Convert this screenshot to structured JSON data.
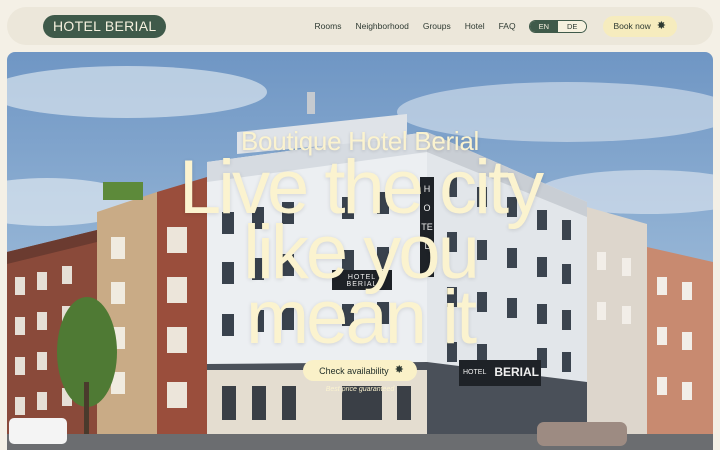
{
  "brand": {
    "logo_text": "HOTEL BERIAL"
  },
  "nav": {
    "links": [
      "Rooms",
      "Neighborhood",
      "Groups",
      "Hotel",
      "FAQ"
    ],
    "languages": [
      "EN",
      "DE"
    ],
    "active_language": "EN",
    "book_label": "Book now",
    "book_icon": "sparkle-icon"
  },
  "hero": {
    "kicker": "Boutique Hotel Berial",
    "title_lines": [
      "Live the city",
      "like you",
      "mean it"
    ],
    "cta_label": "Check availability",
    "cta_icon": "sparkle-icon",
    "cta_note": "Best price guaranteed",
    "building_signs": {
      "vertical": "HOTEL",
      "facade": "HOTEL BERIAL",
      "entrance_left": "HOTEL",
      "entrance_right": "BERIAL"
    }
  },
  "colors": {
    "brand_green": "#3f5a4a",
    "cream": "#f6f1df",
    "accent_yellow": "#f6ecbe",
    "hero_text": "#fbf3cf"
  }
}
